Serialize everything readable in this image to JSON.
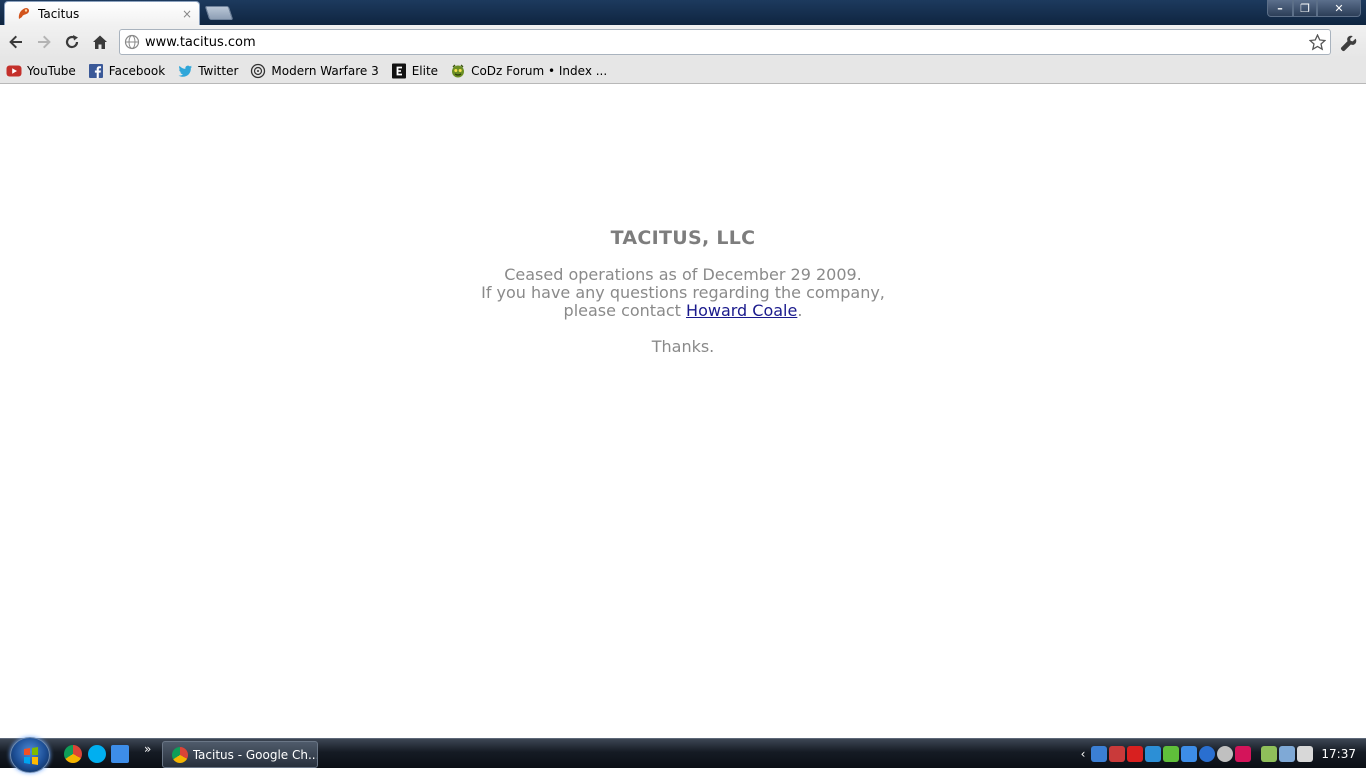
{
  "browser": {
    "tab": {
      "title": "Tacitus",
      "close": "×"
    },
    "window_buttons": {
      "minimize": "–",
      "maximize": "❐",
      "close": "✕"
    },
    "address": {
      "url": "www.tacitus.com"
    },
    "bookmarks": [
      {
        "label": "YouTube",
        "icon": "youtube-icon"
      },
      {
        "label": "Facebook",
        "icon": "facebook-icon"
      },
      {
        "label": "Twitter",
        "icon": "twitter-icon"
      },
      {
        "label": "Modern Warfare 3",
        "icon": "modern-warfare-icon"
      },
      {
        "label": "Elite",
        "icon": "elite-icon"
      },
      {
        "label": "CoDz Forum • Index ...",
        "icon": "codz-forum-icon"
      }
    ]
  },
  "page": {
    "company": "TACITUS, LLC",
    "line1": "Ceased operations as of December 29 2009.",
    "line2": "If you have any questions regarding the company,",
    "line3_prefix": "please contact ",
    "contact_link": "Howard Coale",
    "line3_suffix": ".",
    "thanks": "Thanks."
  },
  "taskbar": {
    "more_label": "»",
    "task_label": "Tacitus - Google Ch...",
    "tray_arrow": "‹",
    "clock": "17:37"
  },
  "colors": {
    "page_text": "#8a8a8a",
    "link": "#1a1a8c",
    "titlebar": "#1d3a5e"
  }
}
